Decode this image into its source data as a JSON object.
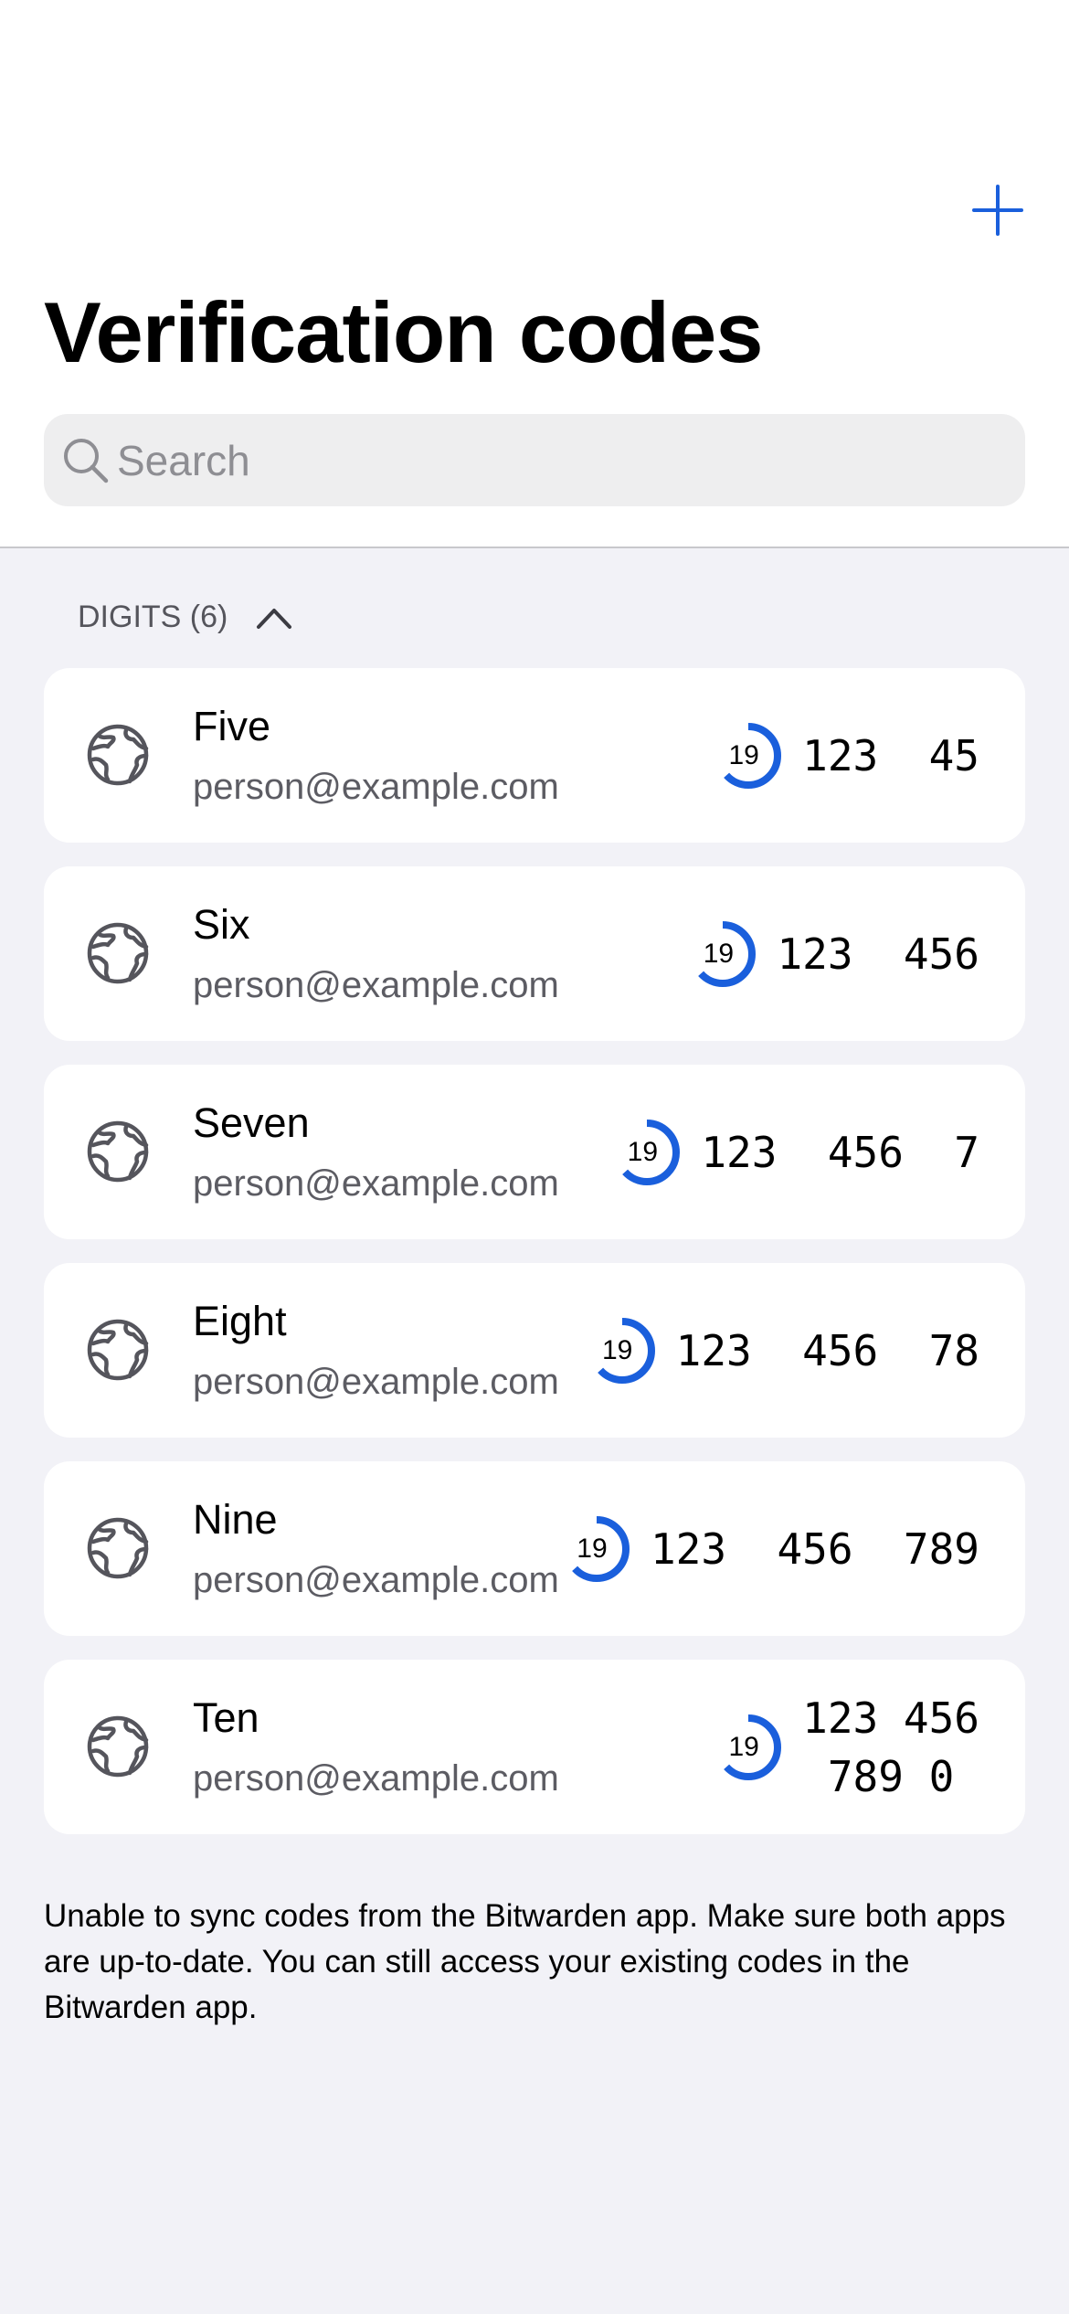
{
  "header": {
    "title": "Verification codes",
    "add_icon": "plus-icon"
  },
  "search": {
    "placeholder": "Search",
    "value": ""
  },
  "section": {
    "label": "DIGITS (6)",
    "expanded": true
  },
  "timer": {
    "seconds": "19",
    "progress": 0.633,
    "color": "#1a5fdc"
  },
  "items": [
    {
      "name": "Five",
      "email": "person@example.com",
      "code": "123  45"
    },
    {
      "name": "Six",
      "email": "person@example.com",
      "code": "123  456"
    },
    {
      "name": "Seven",
      "email": "person@example.com",
      "code": "123  456  7"
    },
    {
      "name": "Eight",
      "email": "person@example.com",
      "code": "123  456  78"
    },
    {
      "name": "Nine",
      "email": "person@example.com",
      "code": "123  456  789"
    },
    {
      "name": "Ten",
      "email": "person@example.com",
      "code": "123 456\n789 0"
    }
  ],
  "footer": "Unable to sync codes from the Bitwarden app. Make sure both apps are up-to-date. You can still access your existing codes in the Bitwarden app."
}
